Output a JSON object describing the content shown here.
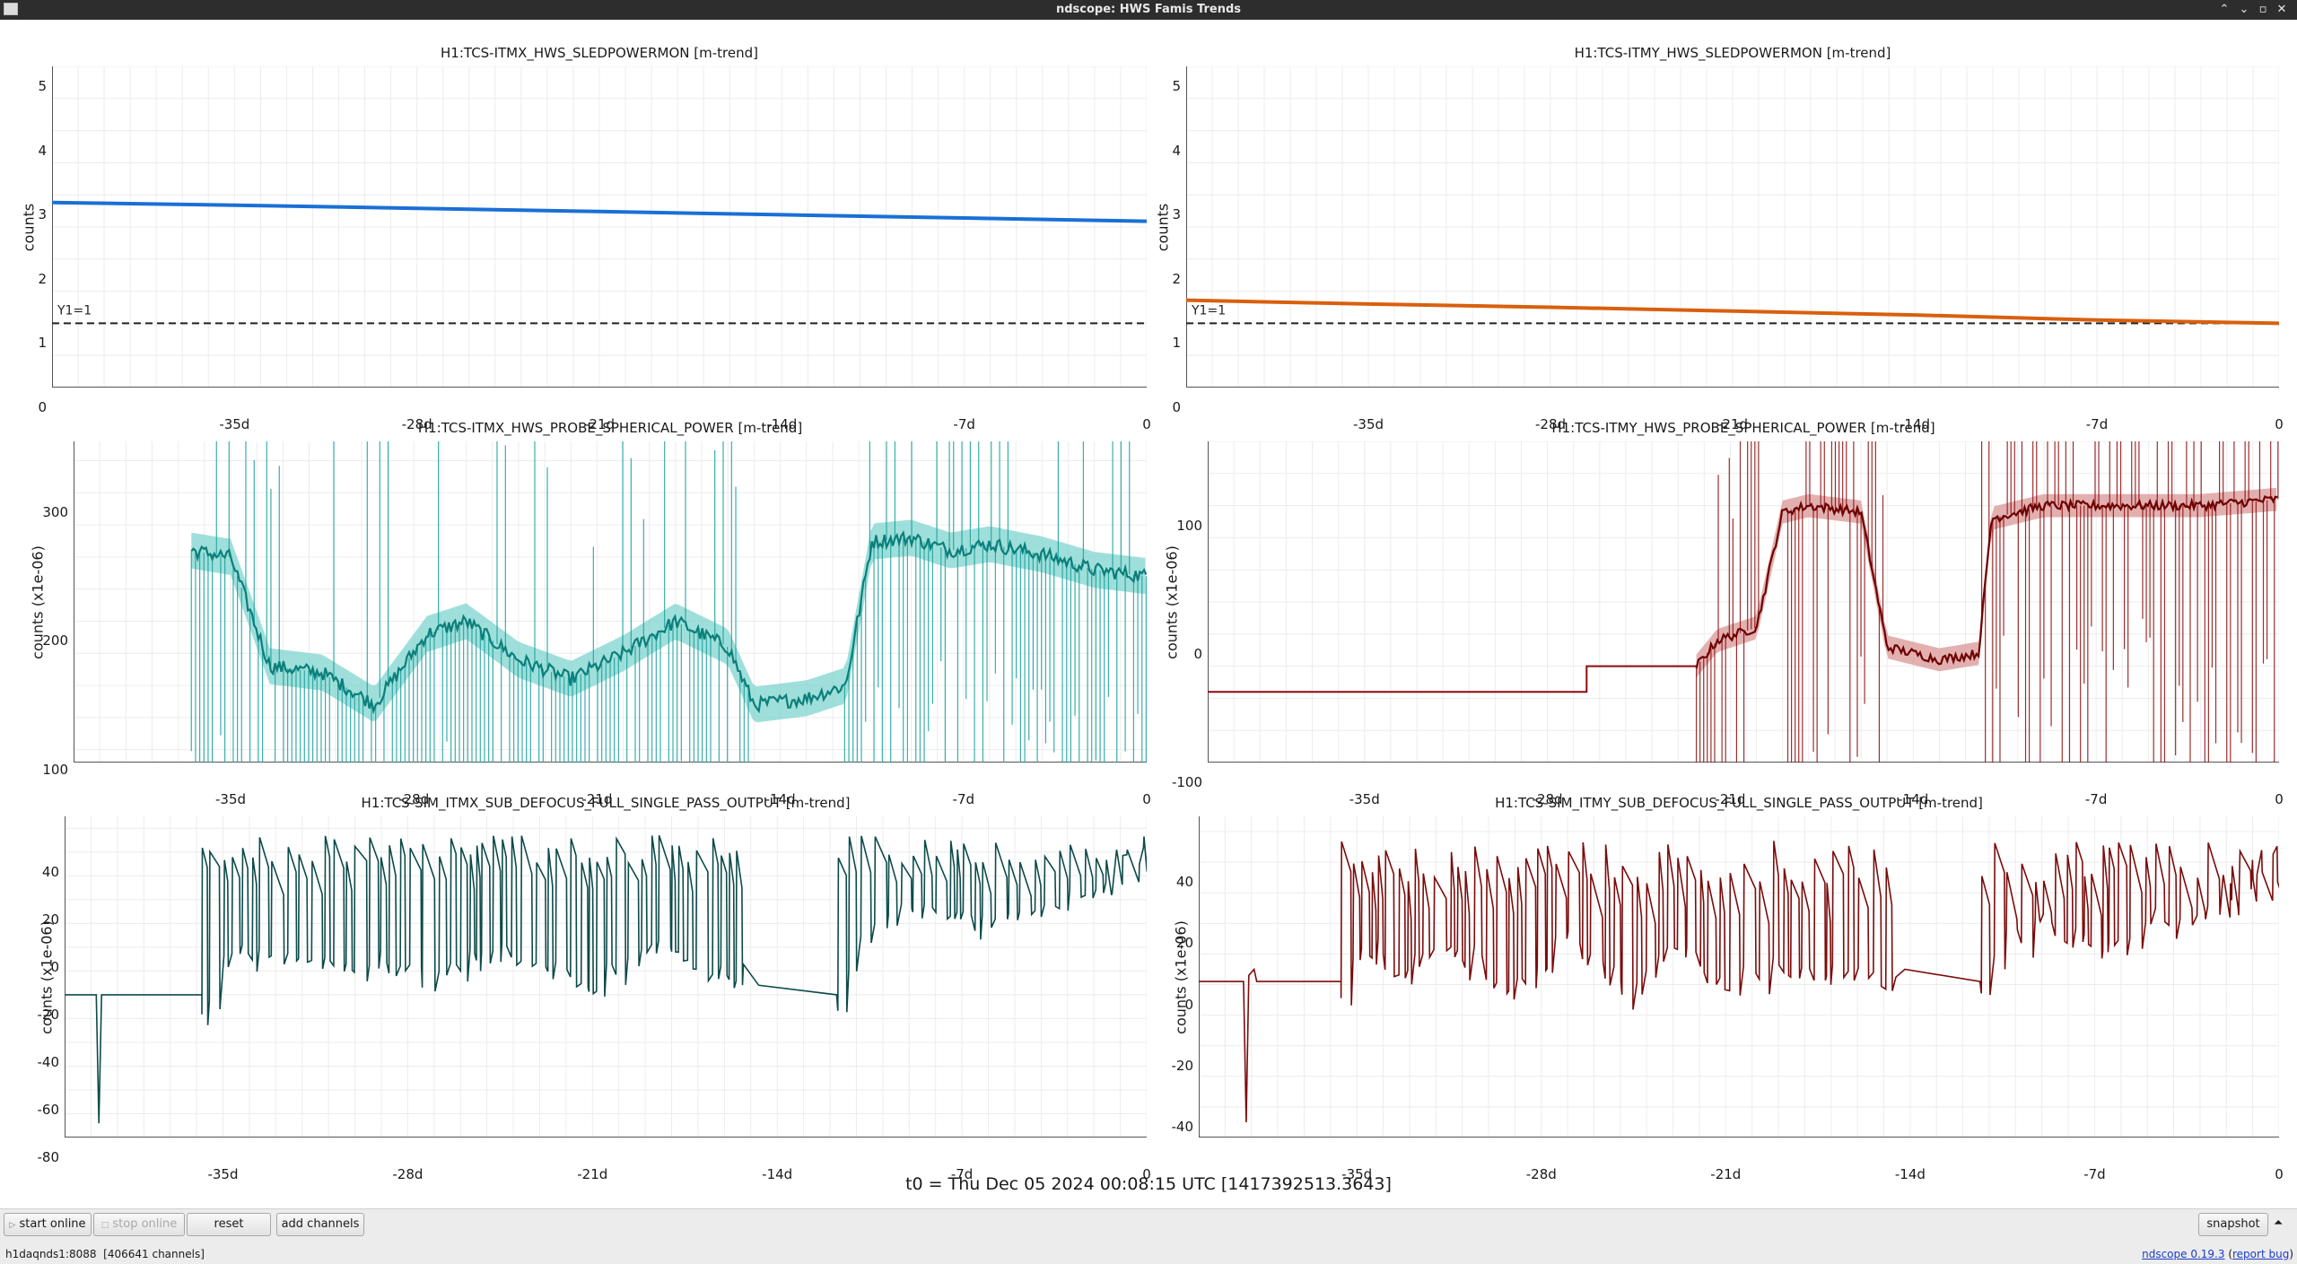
{
  "window": {
    "title": "ndscope: HWS Famis Trends",
    "buttons": [
      "minimize",
      "maximize",
      "close"
    ]
  },
  "plots": [
    {
      "id": "itmx-sledpowermon",
      "title": "H1:TCS-ITMX_HWS_SLEDPOWERMON [m-trend]",
      "ylabel": "counts",
      "yticks": [
        "0",
        "1",
        "2",
        "3",
        "4",
        "5"
      ],
      "xticks": [
        "-35d",
        "-28d",
        "-21d",
        "-14d",
        "-7d",
        "0"
      ],
      "threshold_label": "Y1=1",
      "color": "#1a6fd6"
    },
    {
      "id": "itmy-sledpowermon",
      "title": "H1:TCS-ITMY_HWS_SLEDPOWERMON [m-trend]",
      "ylabel": "counts",
      "yticks": [
        "0",
        "1",
        "2",
        "3",
        "4",
        "5"
      ],
      "xticks": [
        "-35d",
        "-28d",
        "-21d",
        "-14d",
        "-7d",
        "0"
      ],
      "threshold_label": "Y1=1",
      "color": "#d95f0e"
    },
    {
      "id": "itmx-probe-spherical-power",
      "title": "H1:TCS-ITMX_HWS_PROBE_SPHERICAL_POWER [m-trend]",
      "ylabel": "counts (x1e-06)",
      "yticks": [
        "100",
        "200",
        "300"
      ],
      "xticks": [
        "-35d",
        "-28d",
        "-21d",
        "-14d",
        "-7d",
        "0"
      ],
      "color": "#17a09a",
      "band_color": "#7fd4cf"
    },
    {
      "id": "itmy-probe-spherical-power",
      "title": "H1:TCS-ITMY_HWS_PROBE_SPHERICAL_POWER [m-trend]",
      "ylabel": "counts (x1e-06)",
      "yticks": [
        "-100",
        "0",
        "100"
      ],
      "xticks": [
        "-35d",
        "-28d",
        "-21d",
        "-14d",
        "-7d",
        "0"
      ],
      "color": "#8b0a0a",
      "band_color": "#d99595"
    },
    {
      "id": "sim-itmx-defocus",
      "title": "H1:TCS-SIM_ITMX_SUB_DEFOCUS_FULL_SINGLE_PASS_OUTPUT [m-trend]",
      "ylabel": "counts (x1e-06)",
      "yticks": [
        "-80",
        "-60",
        "-40",
        "-20",
        "0",
        "20",
        "40"
      ],
      "xticks": [
        "-35d",
        "-28d",
        "-21d",
        "-14d",
        "-7d",
        "0"
      ],
      "color": "#0d4a4a"
    },
    {
      "id": "sim-itmy-defocus",
      "title": "H1:TCS-SIM_ITMY_SUB_DEFOCUS_FULL_SINGLE_PASS_OUTPUT [m-trend]",
      "ylabel": "counts (x1e-06)",
      "yticks": [
        "-40",
        "-20",
        "0",
        "20",
        "40"
      ],
      "xticks": [
        "-35d",
        "-28d",
        "-21d",
        "-14d",
        "-7d",
        "0"
      ],
      "color": "#7a0c0c"
    }
  ],
  "t0": "t0 = Thu Dec 05 2024 00:08:15 UTC [1417392513.3643]",
  "toolbar": {
    "start_online": "start online",
    "stop_online": "stop online",
    "reset": "reset",
    "add_channels": "add channels",
    "snapshot": "snapshot"
  },
  "status": {
    "server": "h1daqnds1:8088",
    "channels": "[406641 channels]",
    "version_link": "ndscope 0.19.3",
    "report_bug": "report bug"
  },
  "chart_data": [
    {
      "type": "line",
      "title": "H1:TCS-ITMX_HWS_SLEDPOWERMON [m-trend]",
      "ylabel": "counts",
      "xlabel": "",
      "xlim": [
        -42,
        0
      ],
      "ylim": [
        0,
        5
      ],
      "x_unit": "days",
      "series": [
        {
          "values": [
            [
              -42,
              2.88
            ],
            [
              -35,
              2.84
            ],
            [
              -28,
              2.79
            ],
            [
              -21,
              2.74
            ],
            [
              -14,
              2.69
            ],
            [
              -7,
              2.64
            ],
            [
              0,
              2.59
            ]
          ]
        }
      ],
      "reference_line": 1
    },
    {
      "type": "line",
      "title": "H1:TCS-ITMY_HWS_SLEDPOWERMON [m-trend]",
      "ylabel": "counts",
      "xlabel": "",
      "xlim": [
        -42,
        0
      ],
      "ylim": [
        0,
        5
      ],
      "x_unit": "days",
      "series": [
        {
          "values": [
            [
              -42,
              1.36
            ],
            [
              -35,
              1.3
            ],
            [
              -28,
              1.25
            ],
            [
              -21,
              1.19
            ],
            [
              -14,
              1.13
            ],
            [
              -7,
              1.05
            ],
            [
              0,
              1.0
            ]
          ]
        }
      ],
      "reference_line": 1
    },
    {
      "type": "line",
      "title": "H1:TCS-ITMX_HWS_PROBE_SPHERICAL_POWER [m-trend]",
      "ylabel": "counts (x1e-06)",
      "xlabel": "",
      "xlim": [
        -41,
        0
      ],
      "ylim": [
        90,
        340
      ],
      "x_unit": "days",
      "series": [
        {
          "values": [
            [
              -36.5,
              255
            ],
            [
              -35,
              250
            ],
            [
              -33.5,
              165
            ],
            [
              -31.5,
              160
            ],
            [
              -29.5,
              135
            ],
            [
              -27.5,
              190
            ],
            [
              -26,
              200
            ],
            [
              -24,
              170
            ],
            [
              -22,
              155
            ],
            [
              -20,
              175
            ],
            [
              -18,
              200
            ],
            [
              -16,
              180
            ],
            [
              -15,
              135
            ],
            [
              -13,
              140
            ],
            [
              -11.5,
              150
            ],
            [
              -10.5,
              262
            ],
            [
              -9,
              265
            ],
            [
              -7.5,
              255
            ],
            [
              -6,
              260
            ],
            [
              -4,
              252
            ],
            [
              -2,
              240
            ],
            [
              0,
              235
            ]
          ]
        }
      ]
    },
    {
      "type": "line",
      "title": "H1:TCS-ITMY_HWS_PROBE_SPHERICAL_POWER [m-trend]",
      "ylabel": "counts (x1e-06)",
      "xlabel": "",
      "xlim": [
        -41,
        0
      ],
      "ylim": [
        -100,
        150
      ],
      "x_unit": "days",
      "series": [
        {
          "values": [
            [
              -41,
              -45
            ],
            [
              -26.5,
              -45
            ],
            [
              -26.5,
              -25
            ],
            [
              -22.3,
              -25
            ],
            [
              -21.5,
              -5
            ],
            [
              -20,
              5
            ],
            [
              -19,
              95
            ],
            [
              -18,
              100
            ],
            [
              -16,
              95
            ],
            [
              -15,
              -10
            ],
            [
              -13,
              -20
            ],
            [
              -11.5,
              -15
            ],
            [
              -11,
              90
            ],
            [
              -9,
              100
            ],
            [
              -6,
              100
            ],
            [
              -3,
              100
            ],
            [
              0,
              105
            ]
          ]
        }
      ]
    },
    {
      "type": "line",
      "title": "H1:TCS-SIM_ITMX_SUB_DEFOCUS_FULL_SINGLE_PASS_OUTPUT [m-trend]",
      "ylabel": "counts (x1e-06)",
      "xlabel": "",
      "xlim": [
        -41,
        0
      ],
      "ylim": [
        -80,
        55
      ],
      "x_unit": "days",
      "series": [
        {
          "values": [
            [
              -41,
              -20
            ],
            [
              -40,
              -20
            ],
            [
              -39.7,
              -74
            ],
            [
              -39.4,
              -20
            ],
            [
              -35.8,
              -20
            ],
            [
              -35,
              0
            ],
            [
              -33,
              5
            ],
            [
              -31,
              -5
            ],
            [
              -29,
              0
            ],
            [
              -27,
              -10
            ],
            [
              -25,
              5
            ],
            [
              -23,
              0
            ],
            [
              -21,
              -10
            ],
            [
              -19,
              5
            ],
            [
              -17,
              0
            ],
            [
              -15.5,
              -5
            ],
            [
              -14,
              -20
            ],
            [
              -11.7,
              -20
            ],
            [
              -11,
              10
            ],
            [
              -9,
              20
            ],
            [
              -7,
              15
            ],
            [
              -5,
              20
            ],
            [
              -3,
              25
            ],
            [
              0,
              48
            ]
          ]
        }
      ]
    },
    {
      "type": "line",
      "title": "H1:TCS-SIM_ITMY_SUB_DEFOCUS_FULL_SINGLE_PASS_OUTPUT [m-trend]",
      "ylabel": "counts (x1e-06)",
      "xlabel": "",
      "xlim": [
        -41,
        0
      ],
      "ylim": [
        -50,
        55
      ],
      "x_unit": "days",
      "series": [
        {
          "values": [
            [
              -41,
              1
            ],
            [
              -39.3,
              1
            ],
            [
              -39.2,
              -45
            ],
            [
              -39,
              1
            ],
            [
              -35.6,
              1
            ],
            [
              -35,
              20
            ],
            [
              -33,
              10
            ],
            [
              -31,
              15
            ],
            [
              -29,
              5
            ],
            [
              -27,
              20
            ],
            [
              -25,
              5
            ],
            [
              -23,
              15
            ],
            [
              -21,
              5
            ],
            [
              -19,
              10
            ],
            [
              -17,
              10
            ],
            [
              -15.5,
              5
            ],
            [
              -14,
              1
            ],
            [
              -11.5,
              1
            ],
            [
              -11,
              15
            ],
            [
              -9,
              25
            ],
            [
              -7,
              20
            ],
            [
              -5,
              25
            ],
            [
              -3,
              30
            ],
            [
              0,
              48
            ]
          ]
        }
      ]
    }
  ]
}
